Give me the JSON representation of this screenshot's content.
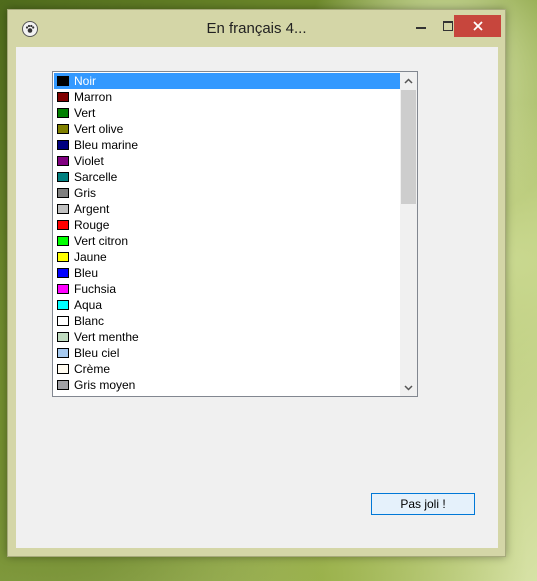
{
  "window": {
    "title": "En français 4..."
  },
  "listbox": {
    "selected_index": 0,
    "items": [
      {
        "label": "Noir",
        "color": "#000000"
      },
      {
        "label": "Marron",
        "color": "#800000"
      },
      {
        "label": "Vert",
        "color": "#008000"
      },
      {
        "label": "Vert olive",
        "color": "#808000"
      },
      {
        "label": "Bleu marine",
        "color": "#000080"
      },
      {
        "label": "Violet",
        "color": "#800080"
      },
      {
        "label": "Sarcelle",
        "color": "#008080"
      },
      {
        "label": "Gris",
        "color": "#808080"
      },
      {
        "label": "Argent",
        "color": "#c0c0c0"
      },
      {
        "label": "Rouge",
        "color": "#ff0000"
      },
      {
        "label": "Vert citron",
        "color": "#00ff00"
      },
      {
        "label": "Jaune",
        "color": "#ffff00"
      },
      {
        "label": "Bleu",
        "color": "#0000ff"
      },
      {
        "label": "Fuchsia",
        "color": "#ff00ff"
      },
      {
        "label": "Aqua",
        "color": "#00ffff"
      },
      {
        "label": "Blanc",
        "color": "#ffffff"
      },
      {
        "label": "Vert menthe",
        "color": "#c0dcc0"
      },
      {
        "label": "Bleu ciel",
        "color": "#a6caf0"
      },
      {
        "label": "Crème",
        "color": "#fffbf0"
      },
      {
        "label": "Gris moyen",
        "color": "#a0a0a4"
      }
    ]
  },
  "button": {
    "label": "Pas joli !"
  },
  "colors": {
    "titlebar": "#d4d6a7",
    "close": "#c7463d",
    "selection": "#3399ff"
  }
}
